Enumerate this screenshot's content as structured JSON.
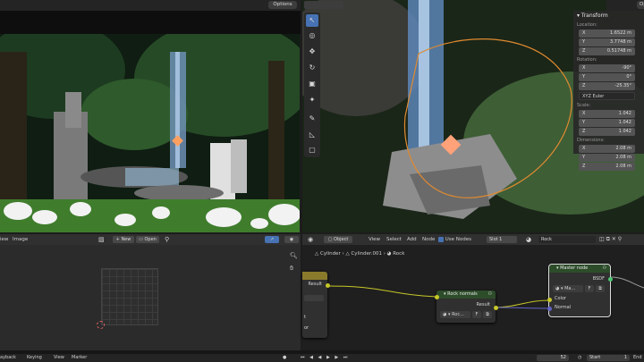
{
  "viewport_header": {
    "options_left": "Options",
    "options_right": "Op"
  },
  "transform_panel": {
    "title": "Transform",
    "location_label": "Location:",
    "location": [
      {
        "axis": "X",
        "value": "1.6522 m"
      },
      {
        "axis": "Y",
        "value": "3.7748 m"
      },
      {
        "axis": "Z",
        "value": "0.51748 m"
      }
    ],
    "rotation_label": "Rotation:",
    "rotation": [
      {
        "axis": "X",
        "value": "-90°"
      },
      {
        "axis": "Y",
        "value": "0°"
      },
      {
        "axis": "Z",
        "value": "-25.35°"
      }
    ],
    "rotation_mode": "XYZ Euler",
    "scale_label": "Scale:",
    "scale": [
      {
        "axis": "X",
        "value": "1.042"
      },
      {
        "axis": "Y",
        "value": "1.042"
      },
      {
        "axis": "Z",
        "value": "1.042"
      }
    ],
    "dimensions_label": "Dimensions:",
    "dimensions": [
      {
        "axis": "X",
        "value": "2.08 m"
      },
      {
        "axis": "Y",
        "value": "2.08 m"
      },
      {
        "axis": "Z",
        "value": "2.08 m"
      }
    ]
  },
  "image_editor": {
    "menu_view": "iew",
    "menu_image": "Image",
    "new_label": "New",
    "open_label": "Open"
  },
  "node_editor": {
    "object_label": "Object",
    "menu_view": "View",
    "menu_select": "Select",
    "menu_add": "Add",
    "menu_node": "Node",
    "use_nodes_label": "Use Nodes",
    "slot_label": "Slot 1",
    "material_name": "Rock",
    "breadcrumb": [
      "Cylinder",
      "Cylinder.001",
      "Rock"
    ],
    "left_node": {
      "output": "Result",
      "lines": [
        "t",
        "or"
      ]
    },
    "rock_normals": {
      "title": "Rock normals",
      "output": "Result",
      "field": "Roc..."
    },
    "master_node": {
      "title": "Master node",
      "output": "BSDF",
      "field": "Ma...",
      "input_color": "Color",
      "input_normal": "Normal"
    }
  },
  "timeline": {
    "menu_playback": "ayback",
    "menu_keying": "Keying",
    "menu_view": "View",
    "menu_marker": "Marker",
    "current_frame": "52",
    "start_label": "Start",
    "start_value": "1",
    "end_label": "End"
  },
  "colors": {
    "accent": "#4772b3",
    "node_header": "#2d4d2a",
    "socket_yellow": "#c7c729",
    "socket_purple": "#6363c7",
    "selection_orange": "#ffa060"
  }
}
